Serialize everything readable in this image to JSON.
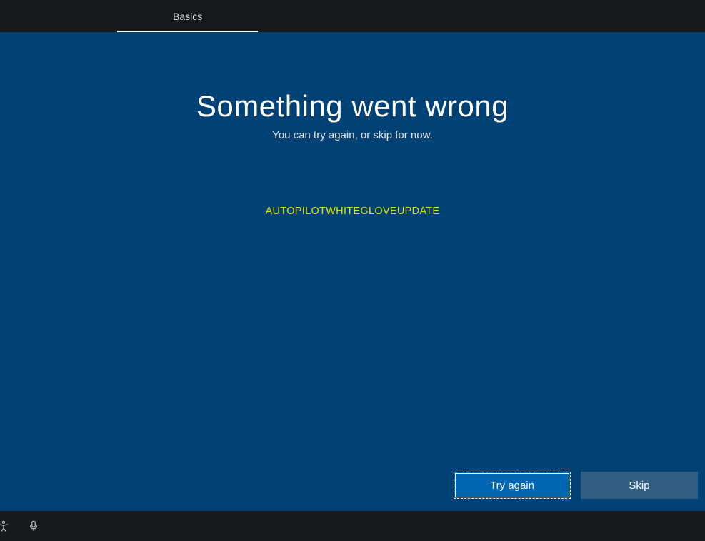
{
  "tabs": {
    "basics": "Basics"
  },
  "main": {
    "heading": "Something went wrong",
    "subtitle": "You can try again, or skip for now.",
    "errorCode": "AUTOPILOTWHITEGLOVEUPDATE"
  },
  "buttons": {
    "tryAgain": "Try again",
    "skip": "Skip"
  }
}
